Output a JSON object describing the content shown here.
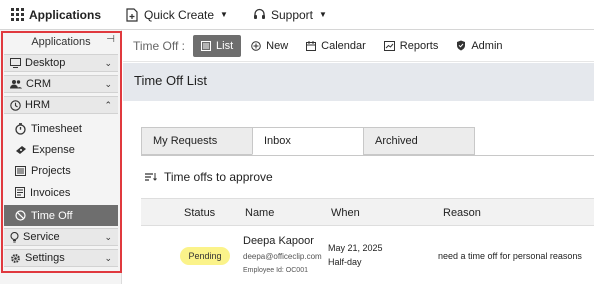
{
  "topbar": {
    "apps_label": "Applications",
    "quick_create_label": "Quick Create",
    "support_label": "Support"
  },
  "sidebar": {
    "header": "Applications",
    "sections": [
      {
        "label": "Desktop",
        "icon": "monitor-icon",
        "state": "collapsed"
      },
      {
        "label": "CRM",
        "icon": "users-icon",
        "state": "collapsed"
      },
      {
        "label": "HRM",
        "icon": "clock-icon",
        "state": "expanded"
      }
    ],
    "hrm_items": [
      {
        "label": "Timesheet",
        "icon": "timer-icon"
      },
      {
        "label": "Expense",
        "icon": "money-icon"
      },
      {
        "label": "Projects",
        "icon": "projects-icon"
      },
      {
        "label": "Invoices",
        "icon": "invoice-icon"
      },
      {
        "label": "Time Off",
        "icon": "timeoff-icon",
        "active": true
      }
    ],
    "footer_sections": [
      {
        "label": "Service",
        "icon": "bulb-icon"
      },
      {
        "label": "Settings",
        "icon": "gear-icon"
      }
    ]
  },
  "toolbar": {
    "context_label": "Time Off :",
    "buttons": [
      "List",
      "New",
      "Calendar",
      "Reports",
      "Admin"
    ],
    "active": "List"
  },
  "page": {
    "title": "Time Off List",
    "tabs": [
      "My Requests",
      "Inbox",
      "Archived"
    ],
    "active_tab": "Inbox",
    "section_title": "Time offs to approve"
  },
  "table": {
    "columns": [
      "Status",
      "Name",
      "When",
      "Reason"
    ],
    "rows": [
      {
        "status": "Pending",
        "name": "Deepa Kapoor",
        "email": "deepa@officeclip.com",
        "employee_id": "Employee Id: OC001",
        "when_date": "May 21, 2025",
        "when_type": "Half-day",
        "reason": "need a time off for personal reasons"
      }
    ]
  },
  "colors": {
    "highlight_border": "#e0393e",
    "active_bg": "#6e6e6e",
    "pending_badge": "#fbf38a",
    "header_bg": "#e5e8ed"
  }
}
